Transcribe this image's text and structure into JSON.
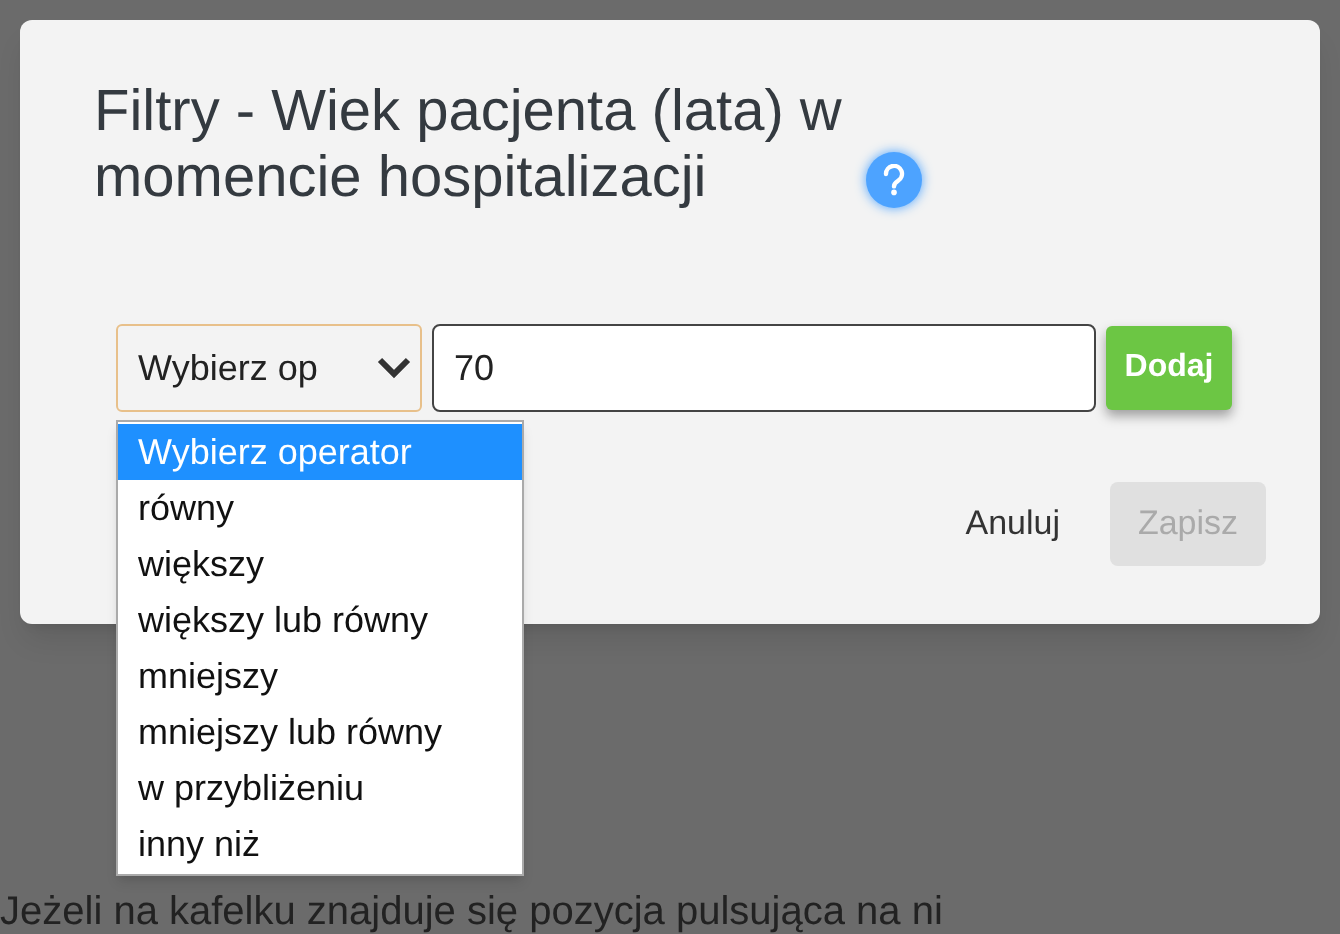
{
  "dialog": {
    "title": "Filtry - Wiek pacjenta (lata) w momencie hospitalizacji",
    "operator_select": {
      "value": "Wybierz op",
      "expanded": true,
      "options": [
        {
          "label": "Wybierz operator",
          "selected": true
        },
        {
          "label": "równy",
          "selected": false
        },
        {
          "label": "większy",
          "selected": false
        },
        {
          "label": "większy lub równy",
          "selected": false
        },
        {
          "label": "mniejszy",
          "selected": false
        },
        {
          "label": "mniejszy lub równy",
          "selected": false
        },
        {
          "label": "w przybliżeniu",
          "selected": false
        },
        {
          "label": "inny niż",
          "selected": false
        }
      ]
    },
    "value_field": {
      "value": "70"
    },
    "add_button": "Dodaj",
    "cancel_button": "Anuluj",
    "save_button": {
      "label": "Zapisz",
      "disabled": true
    }
  },
  "background_text": "Jeżeli na kafelku znajduje się pozycja pulsująca na ni"
}
